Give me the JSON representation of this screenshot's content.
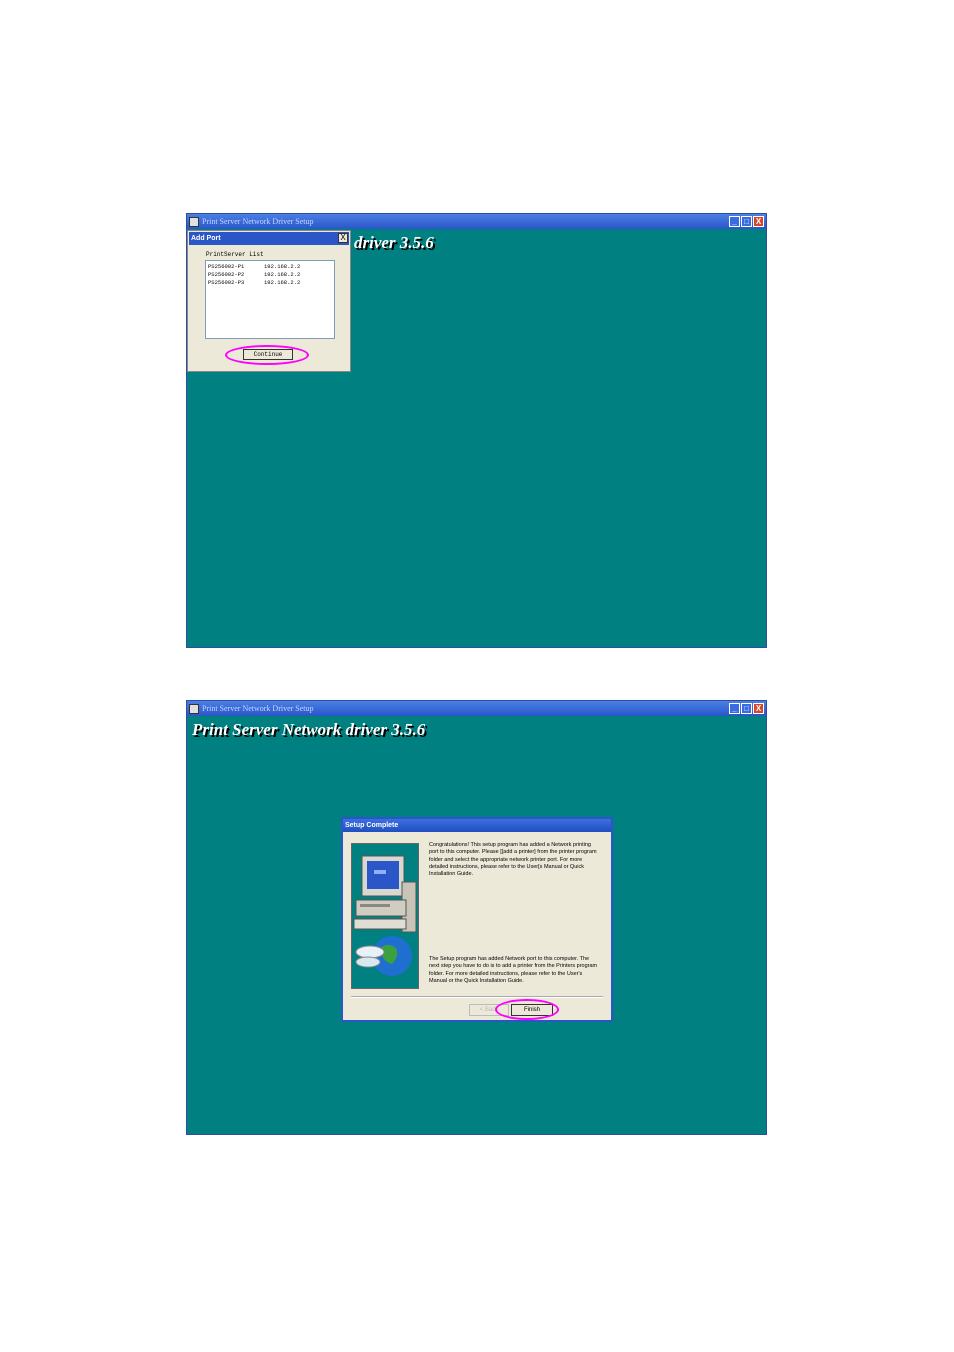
{
  "window": {
    "title": "Print Server Network Driver Setup",
    "heading_partial": "driver 3.5.6",
    "heading_full": "Print Server Network driver 3.5.6",
    "controls": [
      "_",
      "□",
      "X"
    ]
  },
  "add_port": {
    "title": "Add Port",
    "close": "X",
    "list_label": "PrintServer List",
    "servers": [
      {
        "name": "PS256002-P1",
        "ip": "192.168.2.2"
      },
      {
        "name": "PS256002-P2",
        "ip": "192.168.2.2"
      },
      {
        "name": "PS256002-P3",
        "ip": "192.168.2.2"
      }
    ],
    "continue_label": "Continue"
  },
  "setup_complete": {
    "title": "Setup Complete",
    "message1": "Congratulations! This setup program has added a Network printing port to this computer. Please [[add a printer] from the printer program folder and select the appropriate network printer port. For more detailed instructions, please refer to the User[s Manual or Quick Installation Guide.",
    "message2": "The Setup program has added Network port to this computer. The next step you have to do is to add a printer from the Printers program folder. For more detailed instructions, please refer to the User's Manual or the Quick Installation Guide.",
    "back_label": "< Back",
    "finish_label": "Finish"
  },
  "colors": {
    "desktop_teal": "#008080",
    "titlebar_blue": "#2a56c8",
    "highlight_magenta": "#ff00ff",
    "dialog_face": "#ece9d8"
  }
}
